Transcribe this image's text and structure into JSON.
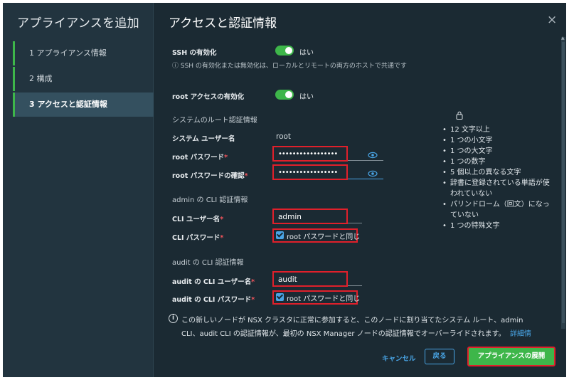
{
  "wizard": {
    "title": "アプライアンスを追加",
    "steps": [
      {
        "label": "1  アプライアンス情報"
      },
      {
        "label": "2  構成"
      },
      {
        "label": "3  アクセスと認証情報"
      }
    ]
  },
  "panel": {
    "title": "アクセスと認証情報",
    "close_glyph": "×"
  },
  "ssh": {
    "label": "SSH の有効化",
    "toggle_text": "はい",
    "note": "ⓘ SSH の有効化または無効化は、ローカルとリモートの両方のホストで共通です"
  },
  "root_access": {
    "label": "root アクセスの有効化",
    "toggle_text": "はい"
  },
  "system_root": {
    "section": "システムのルート認証情報",
    "username_label": "システム ユーザー名",
    "username_value": "root",
    "password_label": "root パスワード",
    "password_value": "•••••••••••••••••",
    "confirm_label": "root パスワードの確認",
    "confirm_value": "•••••••••••••••••",
    "required_mark": "*"
  },
  "admin_cli": {
    "section": "admin の CLI 認証情報",
    "username_label": "CLI ユーザー名",
    "username_value": "admin",
    "password_label": "CLI パスワード",
    "same_as_root": "root パスワードと同じ",
    "required_mark": "*"
  },
  "audit_cli": {
    "section": "audit の CLI 認証情報",
    "username_label": "audit の CLI ユーザー名",
    "username_value": "audit",
    "password_label": "audit の CLI パスワード",
    "same_as_root": "root パスワードと同じ",
    "required_mark": "*"
  },
  "password_rules": [
    "12 文字以上",
    "1 つの小文字",
    "1 つの大文字",
    "1 つの数字",
    "5 個以上の異なる文字",
    "辞書に登録されている単語が使われていない",
    "パリンドローム（回文）になっていない",
    "1 つの特殊文字"
  ],
  "info": {
    "line1": "この新しいノードが NSX クラスタに正常に参加すると、このノードに割り当てたシステム ルート、admin",
    "line2": "CLI、audit CLI の認証情報が、最初の NSX Manager ノードの認証情報でオーバーライドされます。",
    "link": "詳細情"
  },
  "footer": {
    "cancel": "キャンセル",
    "back": "戻る",
    "deploy": "アプライアンスの展開"
  },
  "colors": {
    "accent": "#49a5e6",
    "success": "#3eb64a",
    "highlight": "#e0202b",
    "background": "#1b2a33"
  }
}
